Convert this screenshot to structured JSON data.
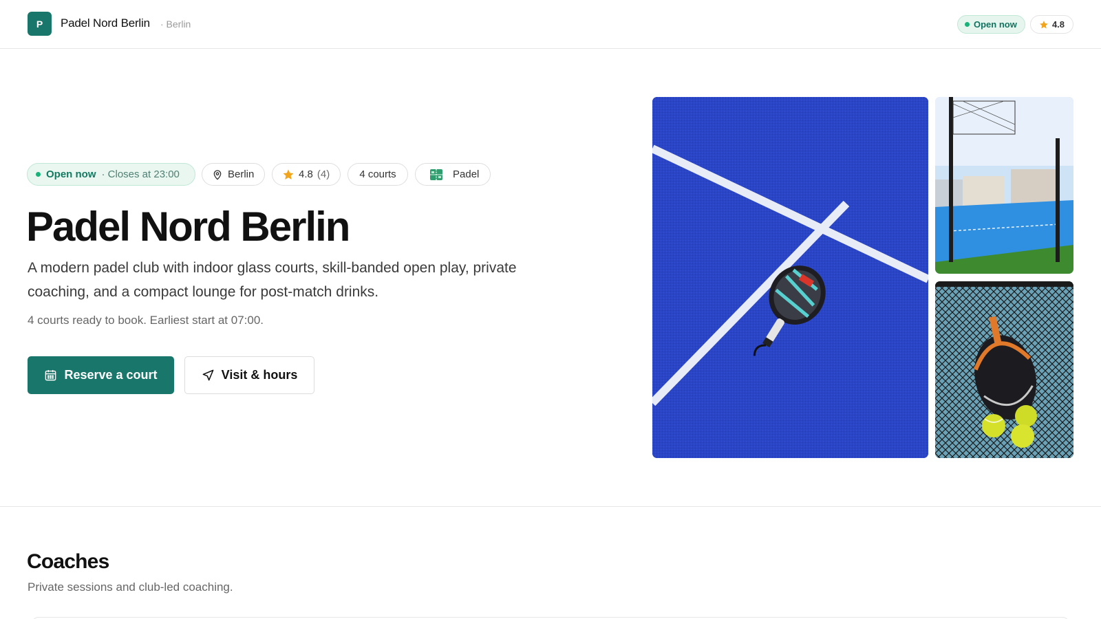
{
  "header": {
    "logo_letter": "P",
    "brand_name": "Padel Nord Berlin",
    "brand_city": "· Berlin",
    "status_label": "Open now",
    "rating": "4.8"
  },
  "hero": {
    "status_open": "Open now",
    "status_close": "· Closes at 23:00",
    "location": "Berlin",
    "rating": "4.8",
    "rating_count": "(4)",
    "courts": "4 courts",
    "sport": "Padel",
    "title": "Padel Nord Berlin",
    "description": "A modern padel club with indoor glass courts, skill-banded open play, private coaching, and a compact lounge for post-match drinks.",
    "note": "4 courts ready to book. Earliest start at 07:00.",
    "primary_button": "Reserve a court",
    "secondary_button": "Visit & hours"
  },
  "coaches": {
    "title": "Coaches",
    "subtitle": "Private sessions and club-led coaching."
  },
  "colors": {
    "brand": "#19766a",
    "open_green": "#19b27a",
    "star": "#f2a51a"
  },
  "icons": {
    "pin": "map-pin-icon",
    "star": "star-icon",
    "court": "court-icon",
    "calendar": "calendar-icon",
    "navigate": "navigation-arrow-icon"
  }
}
